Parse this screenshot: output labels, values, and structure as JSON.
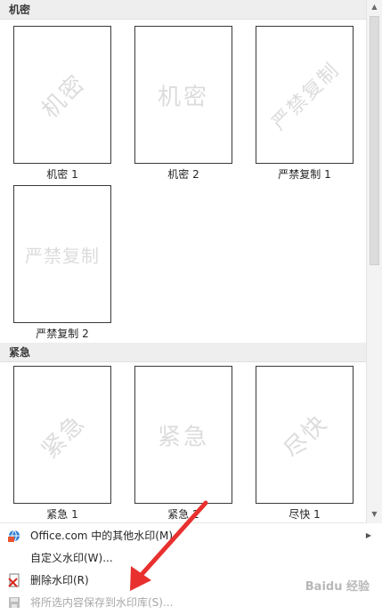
{
  "sections": [
    {
      "title": "机密"
    },
    {
      "title": "紧急"
    }
  ],
  "thumbnails": [
    {
      "watermark": "机密",
      "caption": "机密 1"
    },
    {
      "watermark": "机密",
      "caption": "机密 2"
    },
    {
      "watermark": "严禁复制",
      "caption": "严禁复制 1"
    },
    {
      "watermark": "严禁复制",
      "caption": "严禁复制 2"
    },
    {
      "watermark": "紧急",
      "caption": "紧急 1"
    },
    {
      "watermark": "紧急",
      "caption": "紧急 2"
    },
    {
      "watermark": "尽快",
      "caption": "尽快 1"
    }
  ],
  "menu": {
    "more_watermarks": "Office.com 中的其他水印(M)",
    "custom_watermark": "自定义水印(W)...",
    "remove_watermark": "删除水印(R)",
    "save_to_gallery": "将所选内容保存到水印库(S)..."
  },
  "branding": "Baidu 经验",
  "colors": {
    "highlight_border": "#e8312f",
    "arrow": "#e8312f"
  }
}
